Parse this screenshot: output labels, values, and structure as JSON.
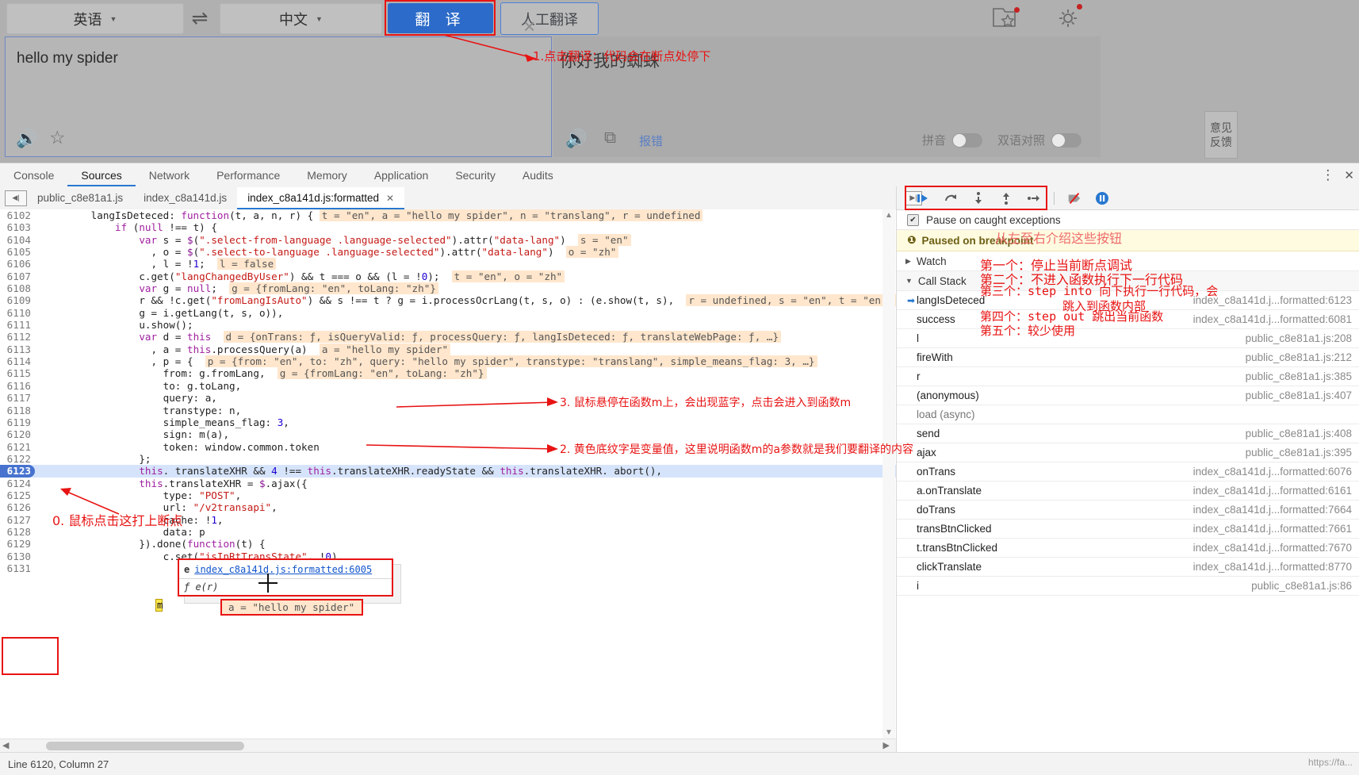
{
  "translate_app": {
    "lang_from": "英语",
    "lang_to": "中文",
    "swap_icon": "swap-icon",
    "translate_button": "翻  译",
    "human_translate_button": "人工翻译",
    "folder_star_icon": "folder-star-icon",
    "gear_icon": "gear-icon",
    "source_text": "hello my spider",
    "target_text": "你好我的蜘蛛",
    "clear_icon": "×",
    "sound_icon": "🔊",
    "star_icon": "☆",
    "copy_icon": "⧉",
    "report_link": "报错",
    "pinyin_label": "拼音",
    "bilingual_label": "双语对照",
    "feedback_line1": "意见",
    "feedback_line2": "反馈"
  },
  "devtools": {
    "panel_tabs": [
      "Console",
      "Sources",
      "Network",
      "Performance",
      "Memory",
      "Application",
      "Security",
      "Audits"
    ],
    "active_panel_tab": "Sources",
    "more_icon": "⋮",
    "close_icon": "✕",
    "file_tabs": [
      {
        "label": "public_c8e81a1.js",
        "active": false,
        "closable": false
      },
      {
        "label": "index_c8a141d.js",
        "active": false,
        "closable": false
      },
      {
        "label": "index_c8a141d.js:formatted",
        "active": true,
        "closable": true
      }
    ],
    "status_bar": "Line 6120, Column 27",
    "status_url": "https://fa...",
    "code_lines": [
      {
        "n": 6102,
        "html": "        langIsDeteced: <span class='kw'>function</span>(t, a, n, r) { <span class='hl'>t = \"en\", a = \"hello my spider\", n = \"translang\", r = undefined</span>"
      },
      {
        "n": 6103,
        "html": "            <span class='kw'>if</span> (<span class='kw'>null</span> !== t) {"
      },
      {
        "n": 6104,
        "html": "                <span class='kw'>var</span> s = <span class='prop'>$</span>(<span class='str'>\".select-from-language .language-selected\"</span>).attr(<span class='str'>\"data-lang\"</span>)  <span class='hl'>s = \"en\"</span>"
      },
      {
        "n": 6105,
        "html": "                  , o = <span class='prop'>$</span>(<span class='str'>\".select-to-language .language-selected\"</span>).attr(<span class='str'>\"data-lang\"</span>)  <span class='hl'>o = \"zh\"</span>"
      },
      {
        "n": 6106,
        "html": "                  , l = !<span class='num'>1</span>;  <span class='hl'>l = false</span>"
      },
      {
        "n": 6107,
        "html": "                c.get(<span class='str'>\"langChangedByUser\"</span>) &amp;&amp; t === o &amp;&amp; (l = !<span class='num'>0</span>);  <span class='hl'>t = \"en\", o = \"zh\"</span>"
      },
      {
        "n": 6108,
        "html": "                <span class='kw'>var</span> g = <span class='kw'>null</span>;  <span class='hl'>g = {fromLang: \"en\", toLang: \"zh\"}</span>"
      },
      {
        "n": 6109,
        "html": "                r &amp;&amp; !c.get(<span class='str'>\"fromLangIsAuto\"</span>) &amp;&amp; s !== t ? g = i.processOcrLang(t, s, o) : (e.show(t, s),  <span class='hl'>r = undefined, s = \"en\", t = \"en\", o</span>"
      },
      {
        "n": 6110,
        "html": "                g = i.getLang(t, s, o)),"
      },
      {
        "n": 6111,
        "html": "                u.show();"
      },
      {
        "n": 6112,
        "html": "                <span class='kw'>var</span> d = <span class='kw'>this</span>  <span class='hl'>d = {onTrans: ƒ, isQueryValid: ƒ, processQuery: ƒ, langIsDeteced: ƒ, translateWebPage: ƒ, …}</span>"
      },
      {
        "n": 6113,
        "html": "                  , a = <span class='kw'>this</span>.processQuery(a)  <span class='hl'>a = \"hello my spider\"</span>"
      },
      {
        "n": 6114,
        "html": "                  , p = {  <span class='hl'>p = {from: \"en\", to: \"zh\", query: \"hello my spider\", transtype: \"translang\", simple_means_flag: 3, …}</span>"
      },
      {
        "n": 6115,
        "html": "                    from: g.fromLang,  <span class='hl'>g = {fromLang: \"en\", toLang: \"zh\"}</span>"
      },
      {
        "n": 6116,
        "html": "                    to: g.toLang,"
      },
      {
        "n": 6117,
        "html": "                    query: a,"
      },
      {
        "n": 6118,
        "html": "                    transtype: n,"
      },
      {
        "n": 6119,
        "html": "                    simple_means_flag: <span class='num'>3</span>,"
      },
      {
        "n": 6120,
        "html": "                    sign: m(a),"
      },
      {
        "n": 6121,
        "html": "                    token: window.common.token"
      },
      {
        "n": 6122,
        "html": "                };"
      },
      {
        "n": 6123,
        "html": "                <span class='kw'>this</span>. translateXHR &amp;&amp; <span class='num'>4</span> !== <span class='kw'>this</span>.translateXHR.readyState &amp;&amp; <span class='kw'>this</span>.translateXHR. abort(),",
        "breakpoint": true
      },
      {
        "n": 6124,
        "html": "                <span class='kw'>this</span>.translateXHR = <span class='prop'>$</span>.ajax({"
      },
      {
        "n": 6125,
        "html": "                    type: <span class='str'>\"POST\"</span>,"
      },
      {
        "n": 6126,
        "html": "                    url: <span class='str'>\"/v2transapi\"</span>,"
      },
      {
        "n": 6127,
        "html": "                    cache: !<span class='num'>1</span>,"
      },
      {
        "n": 6128,
        "html": "                    data: p"
      },
      {
        "n": 6129,
        "html": "                }).done(<span class='kw'>function</span>(t) {"
      },
      {
        "n": 6130,
        "html": "                    c.set(<span class='str'>\"isInRtTransState\"</span>, !<span class='num'>0</span>),"
      },
      {
        "n": 6131,
        "html": "                "
      }
    ],
    "fn_popup": {
      "e_label": "e",
      "link": "index_c8a141d.js:formatted:6005",
      "signature": "ƒ e(r)"
    },
    "cursor_char": "m",
    "hl_box_text": "a = \"hello my spider\""
  },
  "debugger": {
    "dock_icon": "dock-to-right-icon",
    "buttons": [
      {
        "name": "resume-script-execution",
        "glyph": "resume"
      },
      {
        "name": "step-over-next-function-call",
        "glyph": "step-over"
      },
      {
        "name": "step-into-next-function-call",
        "glyph": "step-into"
      },
      {
        "name": "step-out-of-current-function",
        "glyph": "step-out"
      },
      {
        "name": "step",
        "glyph": "step"
      },
      {
        "name": "deactivate-breakpoints",
        "glyph": "deactivate"
      },
      {
        "name": "pause-on-exceptions",
        "glyph": "pause"
      }
    ],
    "pause_on_caught_label": "Pause on caught exceptions",
    "pause_on_caught_checked": true,
    "paused_banner": "Paused on breakpoint",
    "paused_banner_icon": "info-icon",
    "watch_label": "Watch",
    "call_stack_label": "Call Stack",
    "call_stack": [
      {
        "name": "langIsDeteced",
        "location": "index_c8a141d.j...formatted:6123",
        "current": true,
        "async": false
      },
      {
        "name": "success",
        "location": "index_c8a141d.j...formatted:6081",
        "current": false,
        "async": false
      },
      {
        "name": "l",
        "location": "public_c8e81a1.js:208",
        "current": false,
        "async": false
      },
      {
        "name": "fireWith",
        "location": "public_c8e81a1.js:212",
        "current": false,
        "async": false
      },
      {
        "name": "r",
        "location": "public_c8e81a1.js:385",
        "current": false,
        "async": false
      },
      {
        "name": "(anonymous)",
        "location": "public_c8e81a1.js:407",
        "current": false,
        "async": false
      },
      {
        "name": "load (async)",
        "location": "",
        "current": false,
        "async": true
      },
      {
        "name": "send",
        "location": "public_c8e81a1.js:408",
        "current": false,
        "async": false
      },
      {
        "name": "ajax",
        "location": "public_c8e81a1.js:395",
        "current": false,
        "async": false
      },
      {
        "name": "onTrans",
        "location": "index_c8a141d.j...formatted:6076",
        "current": false,
        "async": false
      },
      {
        "name": "a.onTranslate",
        "location": "index_c8a141d.j...formatted:6161",
        "current": false,
        "async": false
      },
      {
        "name": "doTrans",
        "location": "index_c8a141d.j...formatted:7664",
        "current": false,
        "async": false
      },
      {
        "name": "transBtnClicked",
        "location": "index_c8a141d.j...formatted:7661",
        "current": false,
        "async": false
      },
      {
        "name": "t.transBtnClicked",
        "location": "index_c8a141d.j...formatted:7670",
        "current": false,
        "async": false
      },
      {
        "name": "clickTranslate",
        "location": "index_c8a141d.j...formatted:8770",
        "current": false,
        "async": false
      },
      {
        "name": "i",
        "location": "public_c8e81a1.js:86",
        "current": false,
        "async": false
      }
    ]
  },
  "annotations": {
    "step1": "1.点击翻译：代码会在断点处停下",
    "step3": "3. 鼠标悬停在函数m上，会出现蓝字，点击会进入到函数m",
    "step2": "2. 黄色底纹字是变量值，这里说明函数m的a参数就是我们要翻译的内容",
    "step0": "0. 鼠标点击这打上断点",
    "buttons_intro": "从左至右介绍这些按钮",
    "btn1": "第一个：停止当前断点调试",
    "btn2": "第二个：不进入函数执行下一行代码",
    "btn3a": "第三个：step into 向下执行一行代码，会",
    "btn3b": "跳入到函数内部",
    "btn4": "第四个：step out 跳出当前函数",
    "btn5": "第五个：较少使用"
  },
  "colors": {
    "accent_blue": "#2878d0",
    "translate_blue": "#2c6bc9",
    "annotation_red": "#e81313",
    "highlight_orange": "#ffe6cc",
    "breakpoint_blue": "#4773cf"
  }
}
